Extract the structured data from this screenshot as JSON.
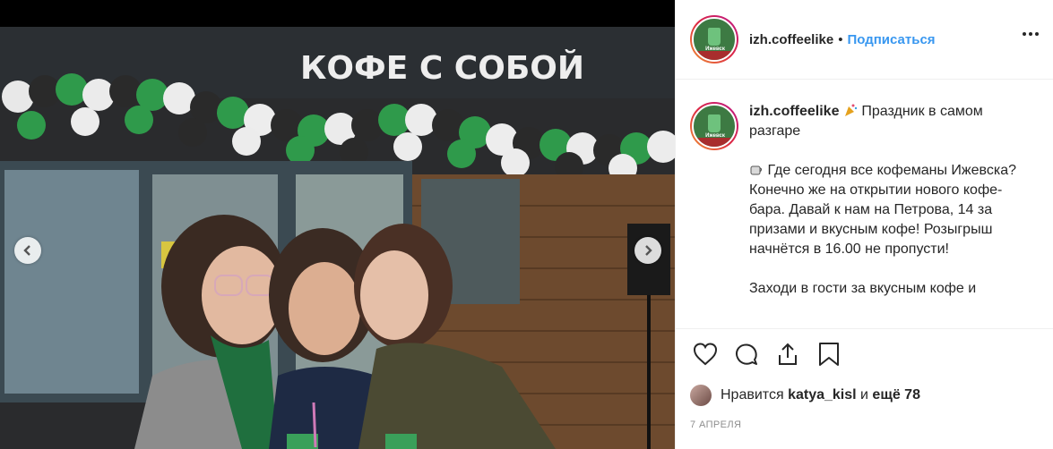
{
  "photo": {
    "sign_text": "КОФЕ С СОБОЙ",
    "prev_icon": "chevron-left-icon",
    "next_icon": "chevron-right-icon"
  },
  "header": {
    "username": "izh.coffeelike",
    "separator": "•",
    "follow_label": "Подписаться",
    "avatar_label": "Ижевск",
    "more_icon": "more-horizontal-icon"
  },
  "caption": {
    "username": "izh.coffeelike",
    "line1": "Праздник в самом разгаре",
    "para2": "Где сегодня все кофеманы Ижевска? Конечно же на открытии нового кофе-бара. Давай к нам на Петрова, 14 за призами и вкусным кофе! Розыгрыш начнётся в 16.00 не пропусти!",
    "para3": "Заходи в гости за вкусным кофе и"
  },
  "actions": {
    "icons": [
      "heart-icon",
      "comment-icon",
      "share-icon",
      "bookmark-icon"
    ],
    "likes_prefix": "Нравится",
    "likes_user": "katya_kisl",
    "likes_middle": "и",
    "likes_count": "ещё 78",
    "date": "7 АПРЕЛЯ"
  },
  "colors": {
    "accent": "#3897f0",
    "text": "#262626",
    "muted": "#8e8e8e",
    "border": "#efefef"
  }
}
